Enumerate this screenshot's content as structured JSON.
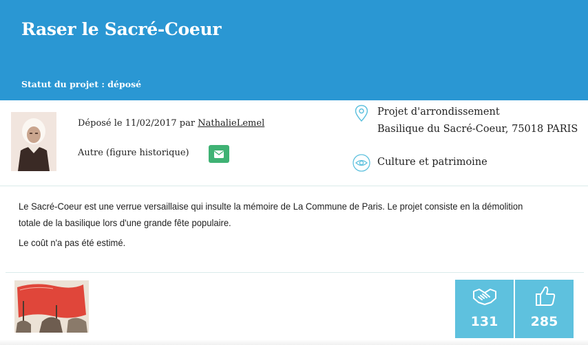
{
  "project": {
    "title": "Raser le Sacré-Coeur",
    "status": "Statut du projet : déposé"
  },
  "meta": {
    "deposit_prefix": "Déposé le 11/02/2017 par ",
    "author": "NathalieLemel",
    "category": "Autre (figure historique)"
  },
  "location": {
    "type": "Projet d'arrondissement",
    "address": "Basilique du Sacré-Coeur, 75018 PARIS",
    "icon": "map-pin-icon"
  },
  "theme": {
    "label": "Culture et patrimoine",
    "icon": "eye-icon"
  },
  "description": {
    "text": "Le Sacré-Coeur est une verrue versaillaise qui insulte la mémoire de La Commune de Paris. Le projet consiste en la démolition totale de la basilique lors d'une grande fête populaire.",
    "cost": "Le coût n'a pas été estimé."
  },
  "votes": {
    "support": {
      "count": "131",
      "icon": "handshake-icon"
    },
    "like": {
      "count": "285",
      "icon": "thumbs-up-icon"
    }
  },
  "colors": {
    "header": "#2a97d3",
    "mail_button": "#3fb274",
    "vote_tile": "#5ec1de",
    "icon_accent": "#5ec1de"
  }
}
